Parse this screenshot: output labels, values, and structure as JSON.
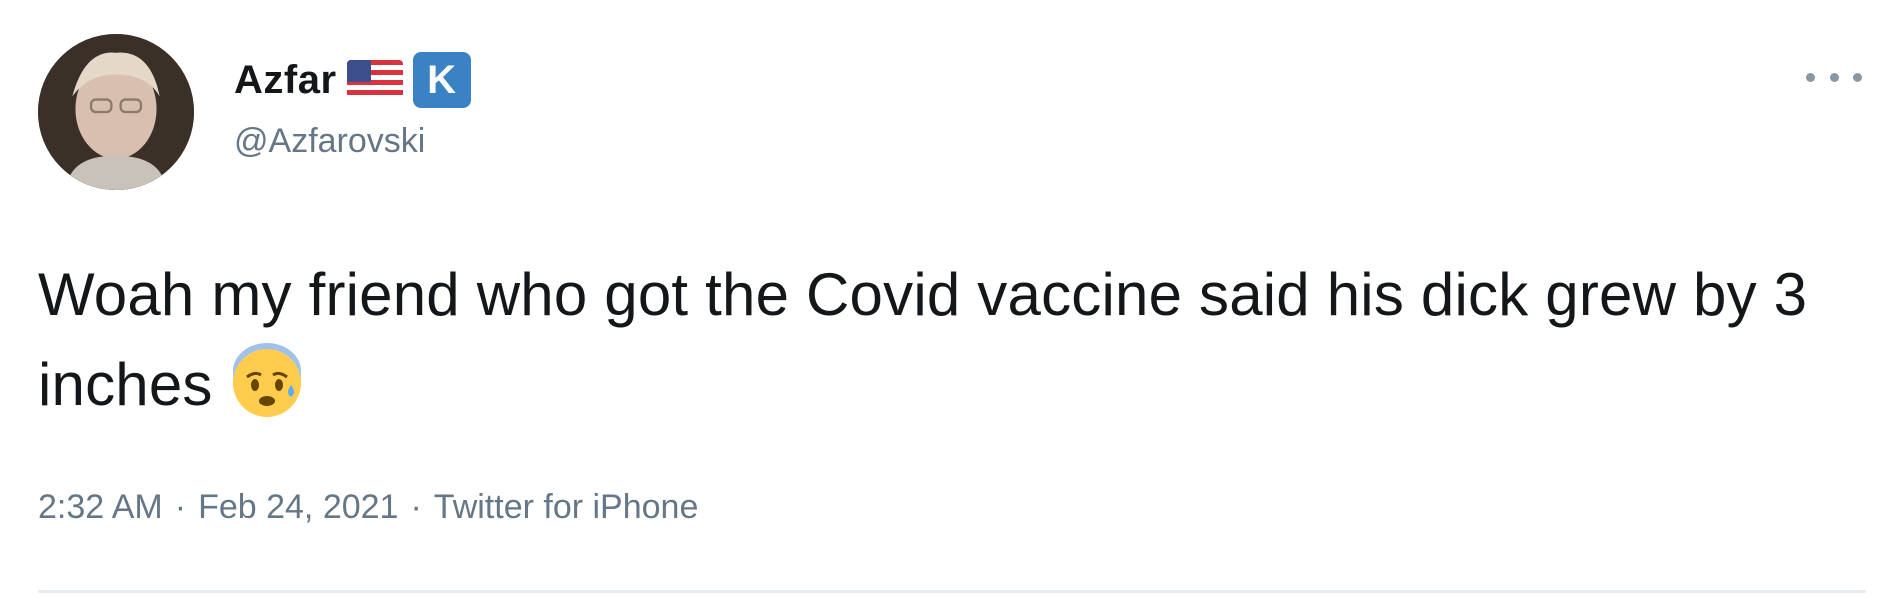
{
  "author": {
    "display_name": "Azfar",
    "handle": "@Azfarovski",
    "badges": [
      "us-flag-icon",
      "kr-icon"
    ],
    "kr_badge_text": "K"
  },
  "tweet": {
    "text": "Woah my friend who got the Covid vaccine said his dick grew by 3 inches",
    "emoji": "anxious-face-with-sweat-icon"
  },
  "meta": {
    "time": "2:32 AM",
    "separator": "·",
    "date": "Feb 24, 2021",
    "source": "Twitter for iPhone"
  },
  "colors": {
    "text_primary": "#14171a",
    "text_secondary": "#657786",
    "divider": "#e6ecf0",
    "kr_badge": "#3b82c4"
  }
}
